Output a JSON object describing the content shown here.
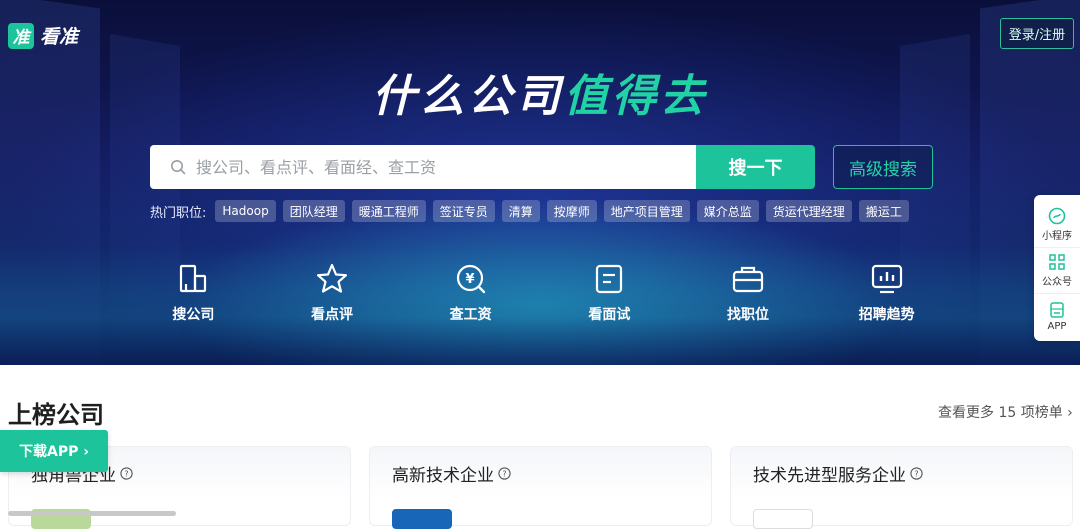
{
  "brand": {
    "mark": "准",
    "name": "看准"
  },
  "header": {
    "login_label": "登录/注册"
  },
  "hero": {
    "slogan_white": "什么公司",
    "slogan_green": "值得去",
    "search": {
      "placeholder": "搜公司、看点评、看面经、查工资",
      "value": ""
    },
    "search_button": "搜一下",
    "advanced_button": "高级搜索",
    "hot_label": "热门职位:",
    "hot_tags": [
      "Hadoop",
      "团队经理",
      "暖通工程师",
      "签证专员",
      "清算",
      "按摩师",
      "地产项目管理",
      "媒介总监",
      "货运代理经理",
      "搬运工"
    ]
  },
  "features": [
    {
      "label": "搜公司",
      "icon": "building-icon"
    },
    {
      "label": "看点评",
      "icon": "star-icon"
    },
    {
      "label": "查工资",
      "icon": "yen-search-icon"
    },
    {
      "label": "看面试",
      "icon": "document-icon"
    },
    {
      "label": "找职位",
      "icon": "briefcase-icon"
    },
    {
      "label": "招聘趋势",
      "icon": "trend-chart-icon"
    }
  ],
  "side_float": [
    {
      "label": "小程序",
      "icon": "mini-program-icon"
    },
    {
      "label": "公众号",
      "icon": "qr-code-icon"
    },
    {
      "label": "APP",
      "icon": "app-download-icon"
    }
  ],
  "ranking": {
    "title": "上榜公司",
    "more_label": "查看更多 15 项榜单",
    "cards": [
      {
        "title": "独角兽企业",
        "snippet": ""
      },
      {
        "title": "高新技术企业",
        "snippet": ""
      },
      {
        "title": "技术先进型服务企业",
        "snippet": ""
      }
    ]
  },
  "download_app": "下载APP ›",
  "colors": {
    "accent": "#1dc39b",
    "hero_bg": "#121a5c"
  }
}
